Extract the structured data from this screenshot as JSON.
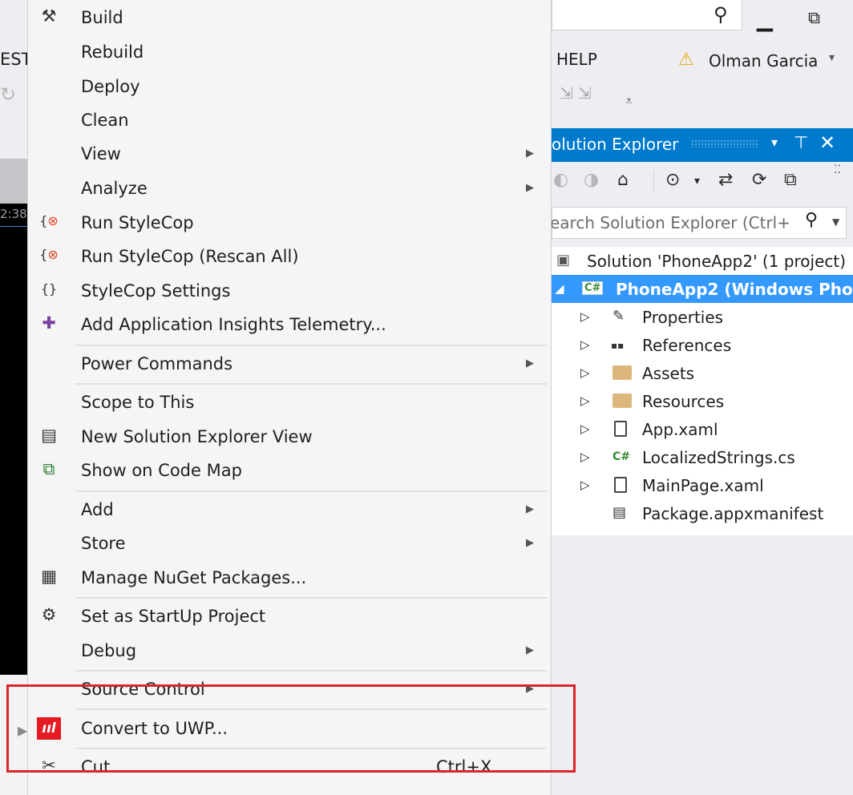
{
  "left_strip": {
    "partial_text": "EST",
    "timestamp_partial": "2:38"
  },
  "titlebar": {
    "search_value": "",
    "minimize_glyph": "▁",
    "restore_glyph": "⧉"
  },
  "menubar": {
    "help_label": "HELP",
    "user_name": "Olman Garcia",
    "warning_glyph": "⚠",
    "caret_glyph": "▾"
  },
  "solution_explorer": {
    "title": "olution Explorer",
    "dropdown_glyph": "▾",
    "pin_glyph": "⊤",
    "close_glyph": "✕",
    "search_placeholder": "earch Solution Explorer (Ctrl+",
    "tree": [
      {
        "label": "Solution 'PhoneApp2' (1 project)",
        "icon": "solution-icon",
        "glyph": "▣",
        "expander": ""
      },
      {
        "label": "PhoneApp2 (Windows Phone",
        "icon": "csharp-project-icon",
        "glyph": "C#",
        "expander": "◢",
        "selected": true
      },
      {
        "label": "Properties",
        "icon": "wrench-icon",
        "glyph": "🔧",
        "expander": "▷"
      },
      {
        "label": "References",
        "icon": "references-icon",
        "glyph": "▪▪",
        "expander": "▷"
      },
      {
        "label": "Assets",
        "icon": "folder-icon",
        "glyph": "▬",
        "expander": "▷"
      },
      {
        "label": "Resources",
        "icon": "folder-icon",
        "glyph": "▬",
        "expander": "▷"
      },
      {
        "label": "App.xaml",
        "icon": "xaml-file-icon",
        "glyph": "▯",
        "expander": "▷"
      },
      {
        "label": "LocalizedStrings.cs",
        "icon": "csharp-file-icon",
        "glyph": "C#",
        "expander": "▷"
      },
      {
        "label": "MainPage.xaml",
        "icon": "xaml-file-icon",
        "glyph": "▯",
        "expander": "▷"
      },
      {
        "label": "Package.appxmanifest",
        "icon": "manifest-icon",
        "glyph": "▤",
        "expander": ""
      }
    ]
  },
  "context_menu": {
    "items": [
      {
        "label": "Build",
        "icon": "build-icon",
        "glyph": "⚒",
        "submenu": false
      },
      {
        "label": "Rebuild",
        "icon": "",
        "glyph": "",
        "submenu": false
      },
      {
        "label": "Deploy",
        "icon": "",
        "glyph": "",
        "submenu": false
      },
      {
        "label": "Clean",
        "icon": "",
        "glyph": "",
        "submenu": false
      },
      {
        "label": "View",
        "icon": "",
        "glyph": "",
        "submenu": true
      },
      {
        "label": "Analyze",
        "icon": "",
        "glyph": "",
        "submenu": true
      },
      {
        "label": "Run StyleCop",
        "icon": "stylecop-run-icon",
        "glyph": "{ }",
        "submenu": false
      },
      {
        "label": "Run StyleCop (Rescan All)",
        "icon": "stylecop-rescan-icon",
        "glyph": "{ }",
        "submenu": false
      },
      {
        "label": "StyleCop Settings",
        "icon": "stylecop-settings-icon",
        "glyph": "{}",
        "submenu": false
      },
      {
        "label": "Add Application Insights Telemetry...",
        "icon": "insights-bulb-icon",
        "glyph": "💡",
        "submenu": false
      },
      {
        "label": "Power Commands",
        "icon": "",
        "glyph": "",
        "submenu": true
      },
      {
        "label": "Scope to This",
        "icon": "",
        "glyph": "",
        "submenu": false
      },
      {
        "label": "New Solution Explorer View",
        "icon": "new-explorer-view-icon",
        "glyph": "▤",
        "submenu": false
      },
      {
        "label": "Show on Code Map",
        "icon": "code-map-icon",
        "glyph": "⧉",
        "submenu": false
      },
      {
        "label": "Add",
        "icon": "",
        "glyph": "",
        "submenu": true
      },
      {
        "label": "Store",
        "icon": "",
        "glyph": "",
        "submenu": true
      },
      {
        "label": "Manage NuGet Packages...",
        "icon": "nuget-icon",
        "glyph": "▦",
        "submenu": false
      },
      {
        "label": "Set as StartUp Project",
        "icon": "gear-icon",
        "glyph": "⚙",
        "submenu": false
      },
      {
        "label": "Debug",
        "icon": "",
        "glyph": "",
        "submenu": true
      },
      {
        "label": "Source Control",
        "icon": "",
        "glyph": "",
        "submenu": true
      },
      {
        "label": "Convert to UWP...",
        "icon": "uwp-convert-icon",
        "glyph": "ııl",
        "submenu": false
      },
      {
        "label": "Cut",
        "icon": "scissors-icon",
        "glyph": "✂",
        "submenu": false,
        "shortcut": "Ctrl+X"
      }
    ],
    "submenu_glyph": "▶"
  },
  "colors": {
    "accent": "#007acc",
    "selection": "#3399ff",
    "highlight_box": "#d9262b",
    "uwp_red": "#e41b23"
  }
}
